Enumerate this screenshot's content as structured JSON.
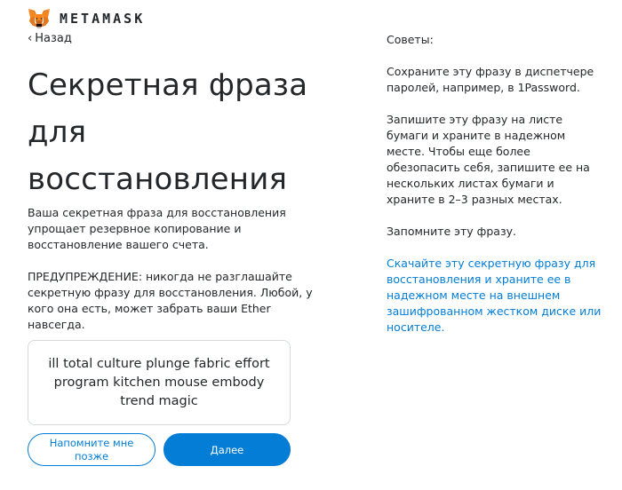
{
  "header": {
    "brand": "METAMASK",
    "back_label": "Назад"
  },
  "main": {
    "title": "Секретная фраза для восстановления",
    "description": "Ваша секретная фраза для восстановления упрощает резервное копирование и восстановление вашего счета.",
    "warning": "ПРЕДУПРЕЖДЕНИЕ: никогда не разглашайте секретную фразу для восстановления. Любой, у кого она есть, может забрать ваши Ether навсегда.",
    "seed_phrase": "ill total culture plunge fabric effort program kitchen mouse embody trend magic",
    "remind_later_label": "Напомните мне позже",
    "next_label": "Далее"
  },
  "tips": {
    "heading": "Советы:",
    "tip1": "Сохраните эту фразу в диспетчере паролей, например, в 1Password.",
    "tip2": "Запишите эту фразу на листе бумаги и храните в надежном месте. Чтобы еще более обезопасить себя, запишите ее на нескольких листах бумаги и храните в 2–3 разных местах.",
    "tip3": "Запомните эту фразу.",
    "download_link": "Скачайте эту секретную фразу для восстановления и храните ее в надежном месте на внешнем зашифрованном жестком диске или носителе."
  },
  "colors": {
    "accent": "#037dd6",
    "text": "#24272a",
    "border": "#d6d9dc",
    "fox_orange": "#e2761b"
  },
  "icons": {
    "logo": "metamask-fox-icon",
    "back": "chevron-left-icon"
  }
}
